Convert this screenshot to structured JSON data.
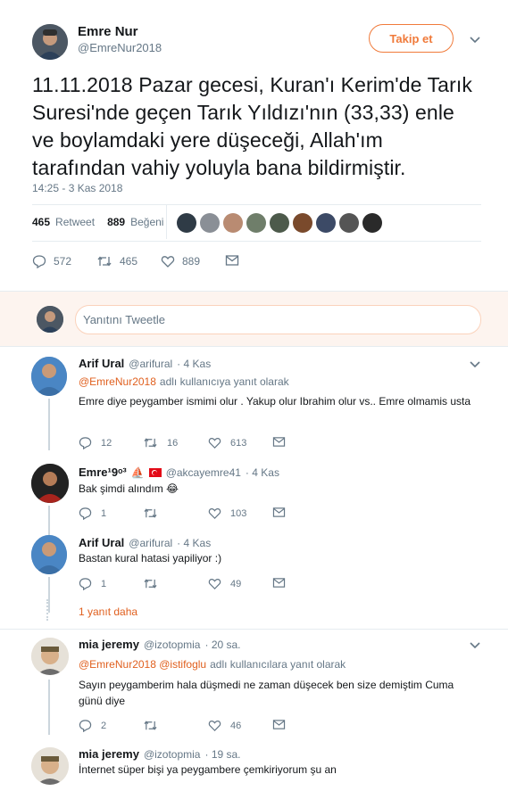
{
  "tweet": {
    "author_name": "Emre Nur",
    "author_handle": "@EmreNur2018",
    "follow_label": "Takip et",
    "text": "11.11.2018 Pazar gecesi, Kuran'ı Kerim'de Tarık Suresi'nde geçen Tarık Yıldızı'nın (33,33) enle ve boylamdaki yere düşeceği, Allah'ım tarafından vahiy yoluyla bana bildirmiştir.",
    "timestamp": "14:25 - 3 Kas 2018",
    "retweet_count": "465",
    "retweet_label": "Retweet",
    "like_count": "889",
    "like_label": "Beğeni",
    "actions": {
      "replies": "572",
      "retweets": "465",
      "likes": "889"
    }
  },
  "reply_box": {
    "placeholder": "Yanıtını Tweetle"
  },
  "replies": [
    {
      "name": "Arif Ural",
      "handle": "@arifural",
      "time": "· 4 Kas",
      "reply_to_handle": "@EmreNur2018",
      "reply_to_suffix": "adlı kullanıcıya yanıt olarak",
      "text": "Emre diye peygamber ismimi olur . Yakup olur Ibrahim olur vs.. Emre olmamis usta",
      "replies": "12",
      "retweets": "16",
      "likes": "613"
    },
    {
      "name": "Emre¹9ᵒ³",
      "handle": "@akcayemre41",
      "time": "· 4 Kas",
      "text": "Bak şimdi alındım 😂",
      "replies": "1",
      "retweets": "",
      "likes": "103"
    },
    {
      "name": "Arif Ural",
      "handle": "@arifural",
      "time": "· 4 Kas",
      "text": "Bastan kural hatasi yapiliyor :)",
      "replies": "1",
      "retweets": "",
      "likes": "49"
    },
    {
      "more_label": "1 yanıt daha"
    },
    {
      "name": "mia jeremy",
      "handle": "@izotopmia",
      "time": "· 20 sa.",
      "reply_to_handle": "@EmreNur2018 @istifoglu",
      "reply_to_suffix": "adlı kullanıcılara yanıt olarak",
      "text": "Sayın peygamberim hala düşmedi ne zaman düşecek ben size demiştim Cuma günü diye",
      "replies": "2",
      "retweets": "",
      "likes": "46"
    },
    {
      "name": "mia jeremy",
      "handle": "@izotopmia",
      "time": "· 19 sa.",
      "text": "İnternet süper bişi ya peygambere çemkiriyorum şu an"
    }
  ],
  "colors": {
    "accent": "#f07a3a",
    "like_avatar_ring": "#ffffff"
  }
}
